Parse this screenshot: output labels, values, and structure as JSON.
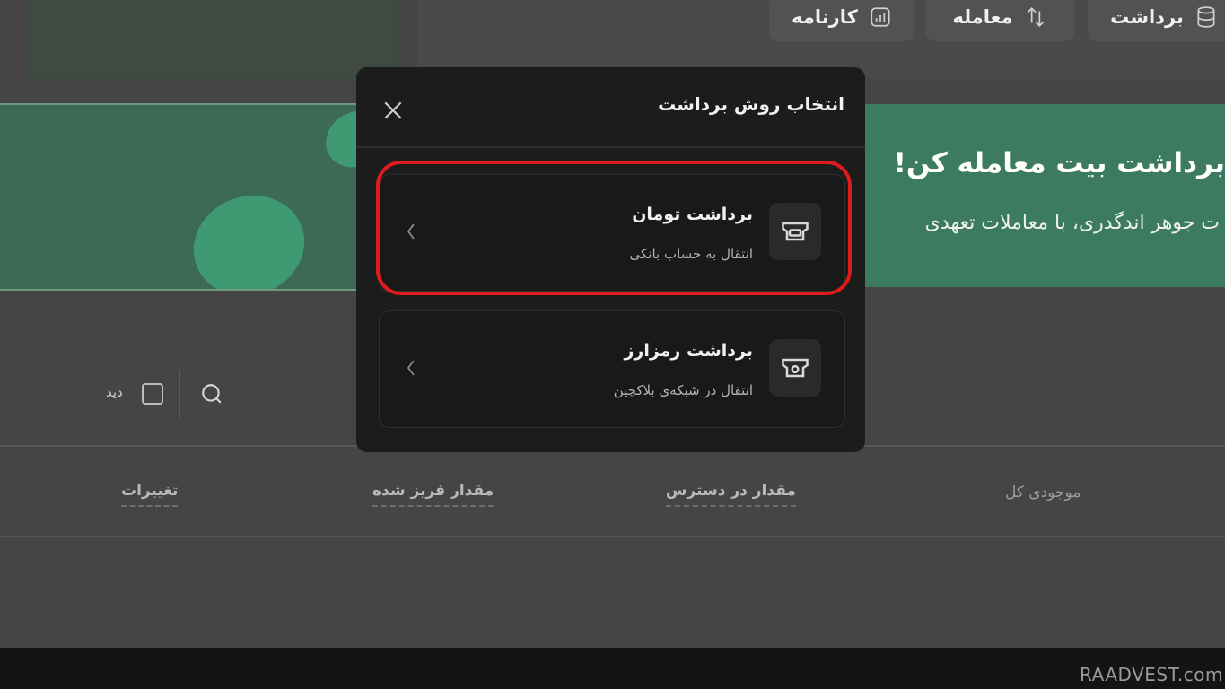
{
  "nav": {
    "items": [
      {
        "label": "برداشت",
        "icon": "database-icon"
      },
      {
        "label": "معامله",
        "icon": "swap-arrows-icon"
      },
      {
        "label": "کارنامه",
        "icon": "report-chart-icon"
      }
    ]
  },
  "banner": {
    "title": "برداشت بیت معامله کن!",
    "subtitle": "ت جوهر اندگدری، با معاملات تعهدی"
  },
  "filter": {
    "label": "دید"
  },
  "table": {
    "columns": [
      "موجودی کل",
      "مقدار در دسترس",
      "مقدار فریز شده",
      "تغییرات"
    ]
  },
  "modal": {
    "title": "انتخاب روش برداشت",
    "options": [
      {
        "title": "برداشت تومان",
        "subtitle": "انتقال به حساب بانکی",
        "highlighted": true
      },
      {
        "title": "برداشت رمزارز",
        "subtitle": "انتقال در شبکه‌ی بلاکچین",
        "highlighted": false
      }
    ]
  },
  "watermark": "RAADVEST.com",
  "colors": {
    "overlay": "#454545",
    "modal_bg": "#1c1c1c",
    "banner_green": "#3c7b5f",
    "highlight_red": "#e01b1b"
  }
}
